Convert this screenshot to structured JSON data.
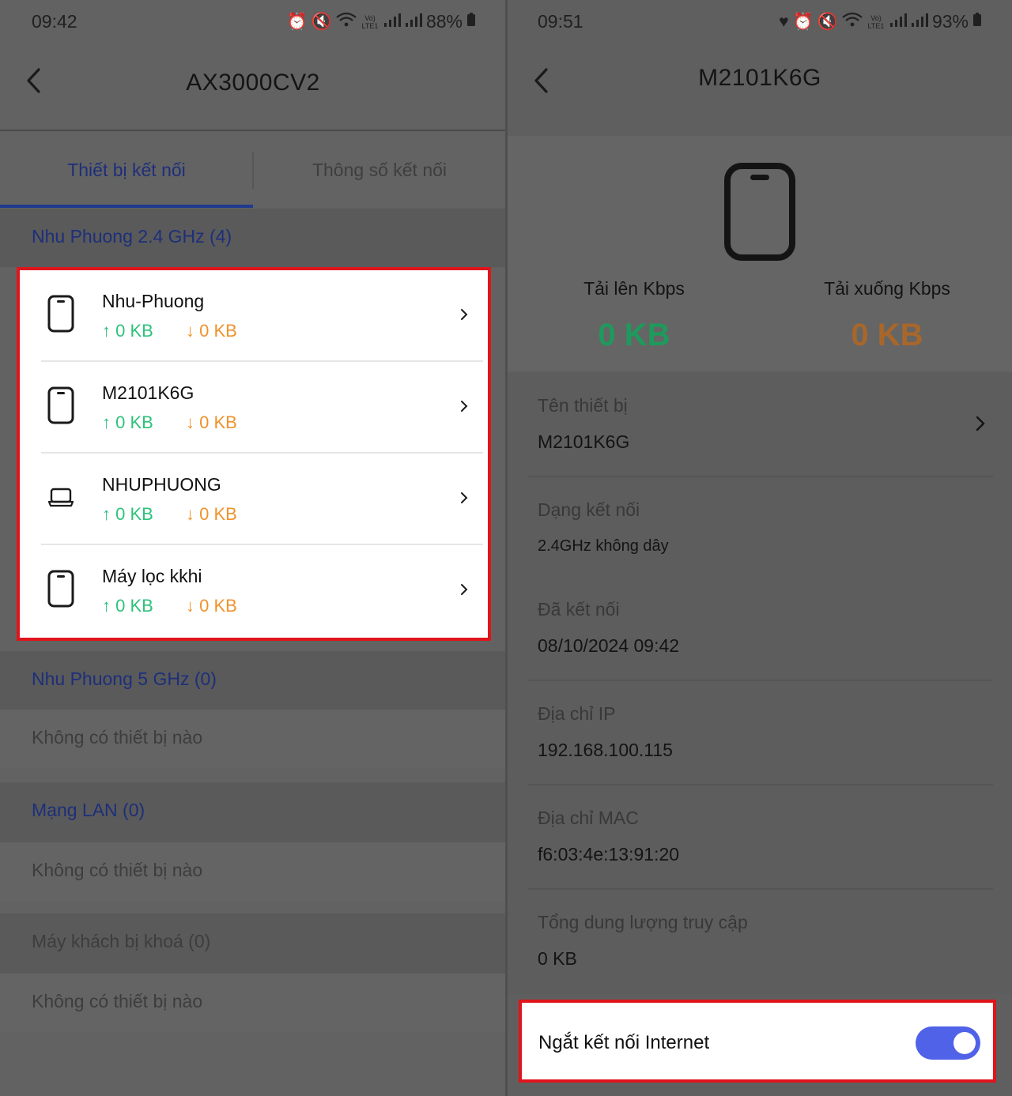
{
  "left": {
    "status": {
      "time": "09:42",
      "battery": "88%"
    },
    "title": "AX3000CV2",
    "tabs": [
      {
        "label": "Thiết bị kết nối"
      },
      {
        "label": "Thông số kết nối"
      }
    ],
    "sections": {
      "wifi24": {
        "title": "Nhu Phuong 2.4 GHz (4)"
      },
      "wifi5": {
        "title": "Nhu Phuong 5 GHz (0)",
        "empty": "Không có thiết bị nào"
      },
      "lan": {
        "title": "Mạng LAN (0)",
        "empty": "Không có thiết bị nào"
      },
      "blocked": {
        "title": "Máy khách bị khoá (0)",
        "empty": "Không có thiết bị nào"
      }
    },
    "devices": [
      {
        "name": "Nhu-Phuong",
        "icon": "phone-icon",
        "up": "↑ 0 KB",
        "down": "↓ 0 KB"
      },
      {
        "name": "M2101K6G",
        "icon": "phone-icon",
        "up": "↑ 0 KB",
        "down": "↓ 0 KB"
      },
      {
        "name": "NHUPHUONG",
        "icon": "laptop-icon",
        "up": "↑ 0 KB",
        "down": "↓ 0 KB"
      },
      {
        "name": "Máy lọc kkhi",
        "icon": "phone-icon",
        "up": "↑ 0 KB",
        "down": "↓ 0 KB"
      }
    ]
  },
  "right": {
    "status": {
      "time": "09:51",
      "battery": "93%"
    },
    "title": "M2101K6G",
    "upload": {
      "label": "Tải lên Kbps",
      "value": "0 KB"
    },
    "download": {
      "label": "Tải xuống Kbps",
      "value": "0 KB"
    },
    "info": [
      {
        "label": "Tên thiết bị",
        "value": "M2101K6G"
      },
      {
        "label": "Dạng kết nối",
        "value": "2.4GHz không dây"
      },
      {
        "label": "Đã kết nối",
        "value": "08/10/2024 09:42"
      },
      {
        "label": "Địa chỉ IP",
        "value": "192.168.100.115"
      },
      {
        "label": "Địa chỉ MAC",
        "value": "f6:03:4e:13:91:20"
      },
      {
        "label": "Tổng dung lượng truy cập",
        "value": "0 KB"
      }
    ],
    "disconnect": {
      "label": "Ngắt kết nối Internet",
      "enabled": true
    }
  },
  "statusbar_icons": {
    "signal_tag": "Vo) LTE1"
  },
  "colors": {
    "accent": "#1f3a8f",
    "upload": "#2ec27b",
    "download": "#f0922b",
    "toggle": "#4f62e8",
    "highlight": "#e0141b"
  }
}
